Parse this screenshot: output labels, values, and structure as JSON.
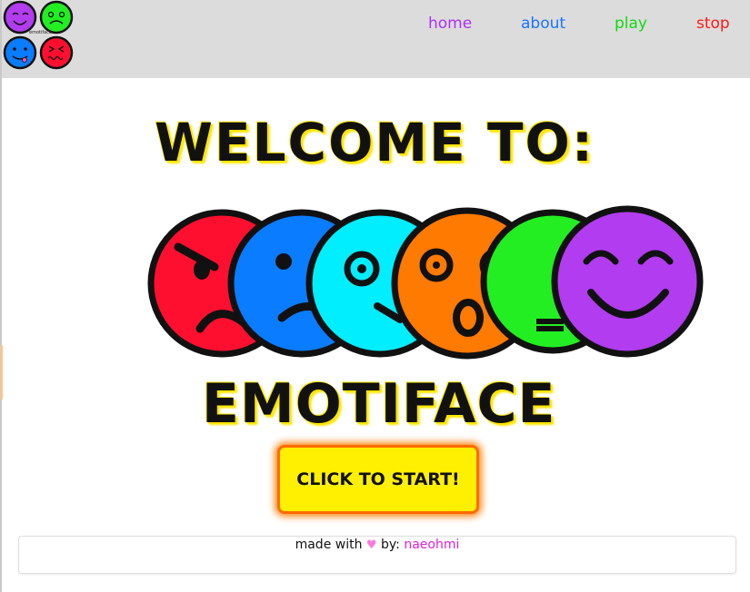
{
  "header": {
    "logo_caption": "emotiface",
    "nav": [
      {
        "label": "home",
        "color": "#aa30ff"
      },
      {
        "label": "about",
        "color": "#1a73ff"
      },
      {
        "label": "play",
        "color": "#12d812"
      },
      {
        "label": "stop",
        "color": "#ff1818"
      }
    ]
  },
  "hero": {
    "welcome_text": "WELCOME TO:",
    "brand_name": "EMOTIFACE",
    "faces": [
      {
        "emotion": "angry",
        "color": "#ff0f2f"
      },
      {
        "emotion": "sad",
        "color": "#0a7cff"
      },
      {
        "emotion": "confused",
        "color": "#00eeff"
      },
      {
        "emotion": "surprised",
        "color": "#ff7a00"
      },
      {
        "emotion": "disgusted",
        "color": "#22ee22"
      },
      {
        "emotion": "happy",
        "color": "#b23cf0"
      }
    ],
    "start_button_label": "CLICK TO START!"
  },
  "footer": {
    "made_with": "made with",
    "heart": "♥",
    "by": "by:",
    "author": "naeohmi"
  },
  "colors": {
    "header_bg": "#dcdcdc",
    "button_bg": "#ffef00",
    "button_border": "#ff6a00",
    "title_glow": "#ffe600"
  }
}
